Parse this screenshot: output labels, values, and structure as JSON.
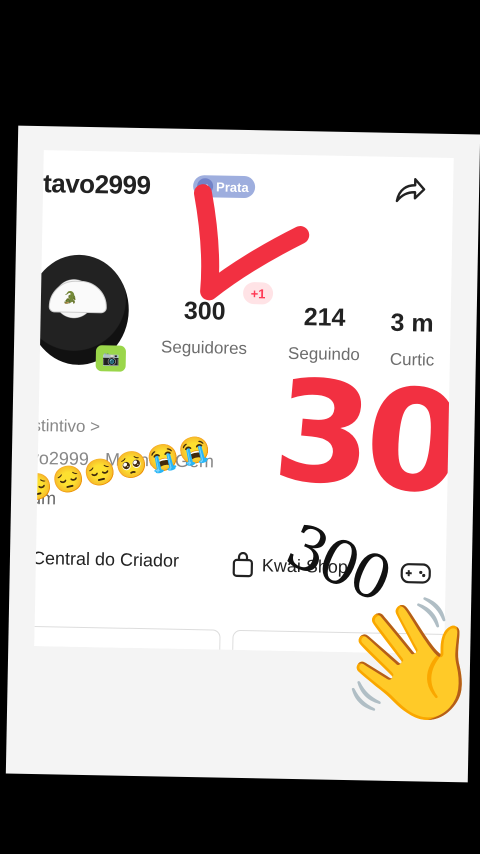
{
  "profile": {
    "username": "tavo2999",
    "badge": "Prata",
    "distintivo": "stintivo >",
    "info_name": "vo2999",
    "info_gender": "Ma   ino",
    "info_sign": "Gém",
    "bio_fragment": "um"
  },
  "stats": {
    "followers_count": "300",
    "followers_label": "Seguidores",
    "followers_delta": "+1",
    "following_count": "214",
    "following_label": "Seguindo",
    "likes_count": "3 m",
    "likes_label": "Curtic"
  },
  "actions": {
    "creator_central": "Central do Criador",
    "kwai_shop": "Kwai Shop"
  },
  "overlay": {
    "big_text": "30",
    "handwritten": "300"
  },
  "icons": {
    "share": "share-icon",
    "bag": "bag-icon",
    "game": "gamepad-icon",
    "hand": "waving-hand-icon"
  },
  "emojis": "😔😔😔🥺😭😭",
  "accent_red": "#f23041"
}
